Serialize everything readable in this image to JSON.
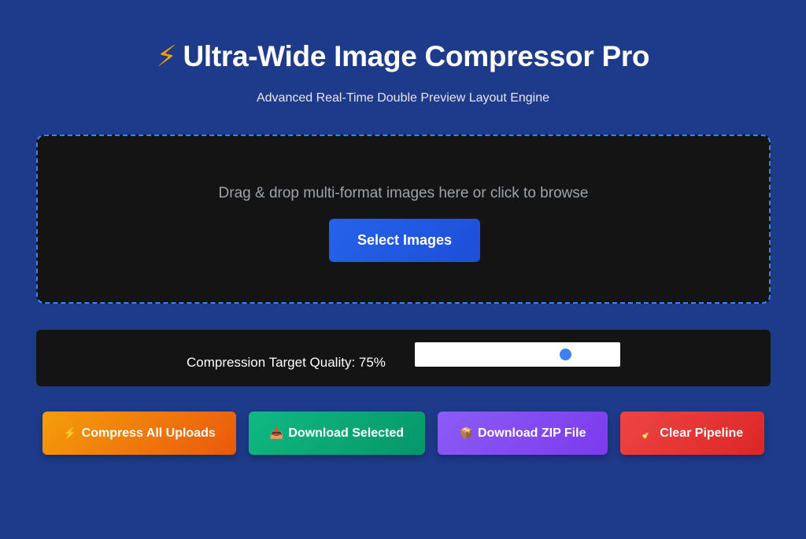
{
  "header": {
    "title_icon": "⚡",
    "title": "Ultra-Wide Image Compressor Pro",
    "subtitle": "Advanced Real-Time Double Preview Layout Engine"
  },
  "dropzone": {
    "prompt": "Drag & drop multi-format images here or click to browse",
    "select_label": "Select Images"
  },
  "quality": {
    "label": "Compression Target Quality: 75%",
    "value": 75
  },
  "actions": {
    "compress": {
      "icon": "⚡",
      "label": "Compress All Uploads"
    },
    "download": {
      "icon": "📥",
      "label": "Download Selected"
    },
    "zip": {
      "icon": "📦",
      "label": "Download ZIP File"
    },
    "clear": {
      "icon": "🧹",
      "label": "Clear Pipeline"
    }
  },
  "colors": {
    "background": "#1e3a8a",
    "panel": "#141414",
    "accent": "#3b82f6"
  }
}
